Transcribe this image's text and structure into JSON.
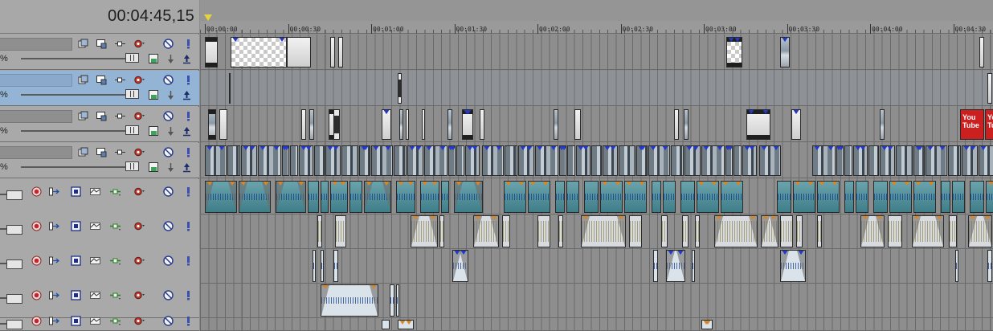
{
  "timecode": "00:04:45,15",
  "ruler": {
    "labels": [
      "00:00:00",
      "00:00:30",
      "00:01:00",
      "00:01:30",
      "00:02:00",
      "00:02:30",
      "00:03:00",
      "00:03:30",
      "00:04:00",
      "00:04:30"
    ]
  },
  "video_tracks": [
    {
      "id": "v1",
      "opacity": "%",
      "selected": false
    },
    {
      "id": "v2",
      "opacity": "%",
      "selected": true
    },
    {
      "id": "v3",
      "opacity": "%",
      "selected": false
    },
    {
      "id": "v4",
      "opacity": "%",
      "selected": false
    }
  ],
  "audio_tracks": [
    {
      "id": "a1"
    },
    {
      "id": "a2"
    },
    {
      "id": "a3"
    },
    {
      "id": "a4"
    },
    {
      "id": "a5"
    }
  ],
  "icons": {
    "composite": "composite-mode-icon",
    "motion": "track-motion-icon",
    "fx": "track-fx-icon",
    "automation": "automation-gear-icon",
    "mute": "mute-icon",
    "solo": "solo-icon",
    "arm": "record-arm-icon",
    "input": "input-bus-icon",
    "monitor": "input-monitor-icon",
    "lock": "lock-envelope-icon",
    "compositing_child": "compositing-child-icon",
    "make_parent": "make-compositing-parent-icon"
  },
  "colors": {
    "header_bg": "#a9a9a9",
    "selected_track": "#94b4d6",
    "timeline_bg": "#8e8e8e",
    "audio_clip_teal": "#4d8c97",
    "youtube_red": "#cc1f1f"
  },
  "youtube_clip_text": [
    "You",
    "Tube"
  ]
}
